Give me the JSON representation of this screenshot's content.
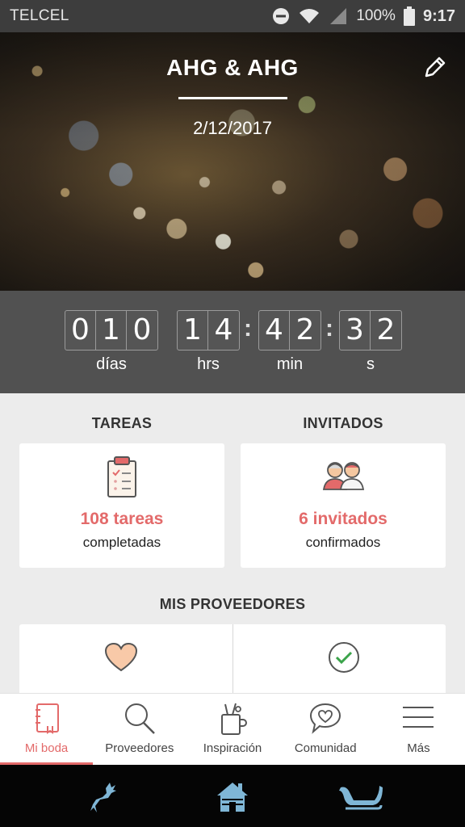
{
  "status_bar": {
    "carrier": "TELCEL",
    "battery": "100%",
    "time": "9:17"
  },
  "hero": {
    "title": "AHG & AHG",
    "date": "2/12/2017"
  },
  "countdown": {
    "days": [
      "0",
      "1",
      "0"
    ],
    "hours": [
      "1",
      "4"
    ],
    "minutes": [
      "4",
      "2"
    ],
    "seconds": [
      "3",
      "2"
    ],
    "days_label": "días",
    "hours_label": "hrs",
    "minutes_label": "min",
    "seconds_label": "s"
  },
  "tasks": {
    "heading": "TAREAS",
    "count": "108 tareas",
    "status": "completadas"
  },
  "guests": {
    "heading": "INVITADOS",
    "count": "6 invitados",
    "status": "confirmados"
  },
  "providers": {
    "heading": "MIS PROVEEDORES"
  },
  "tabs": [
    {
      "label": "Mi boda",
      "icon": "notebook-icon",
      "active": true
    },
    {
      "label": "Proveedores",
      "icon": "search-icon",
      "active": false
    },
    {
      "label": "Inspiración",
      "icon": "pencil-cup-icon",
      "active": false
    },
    {
      "label": "Comunidad",
      "icon": "chat-heart-icon",
      "active": false
    },
    {
      "label": "Más",
      "icon": "menu-icon",
      "active": false
    }
  ],
  "colors": {
    "accent": "#e36a6a",
    "countdown_bg": "#515151",
    "nav_icon": "#7fb6d6"
  }
}
